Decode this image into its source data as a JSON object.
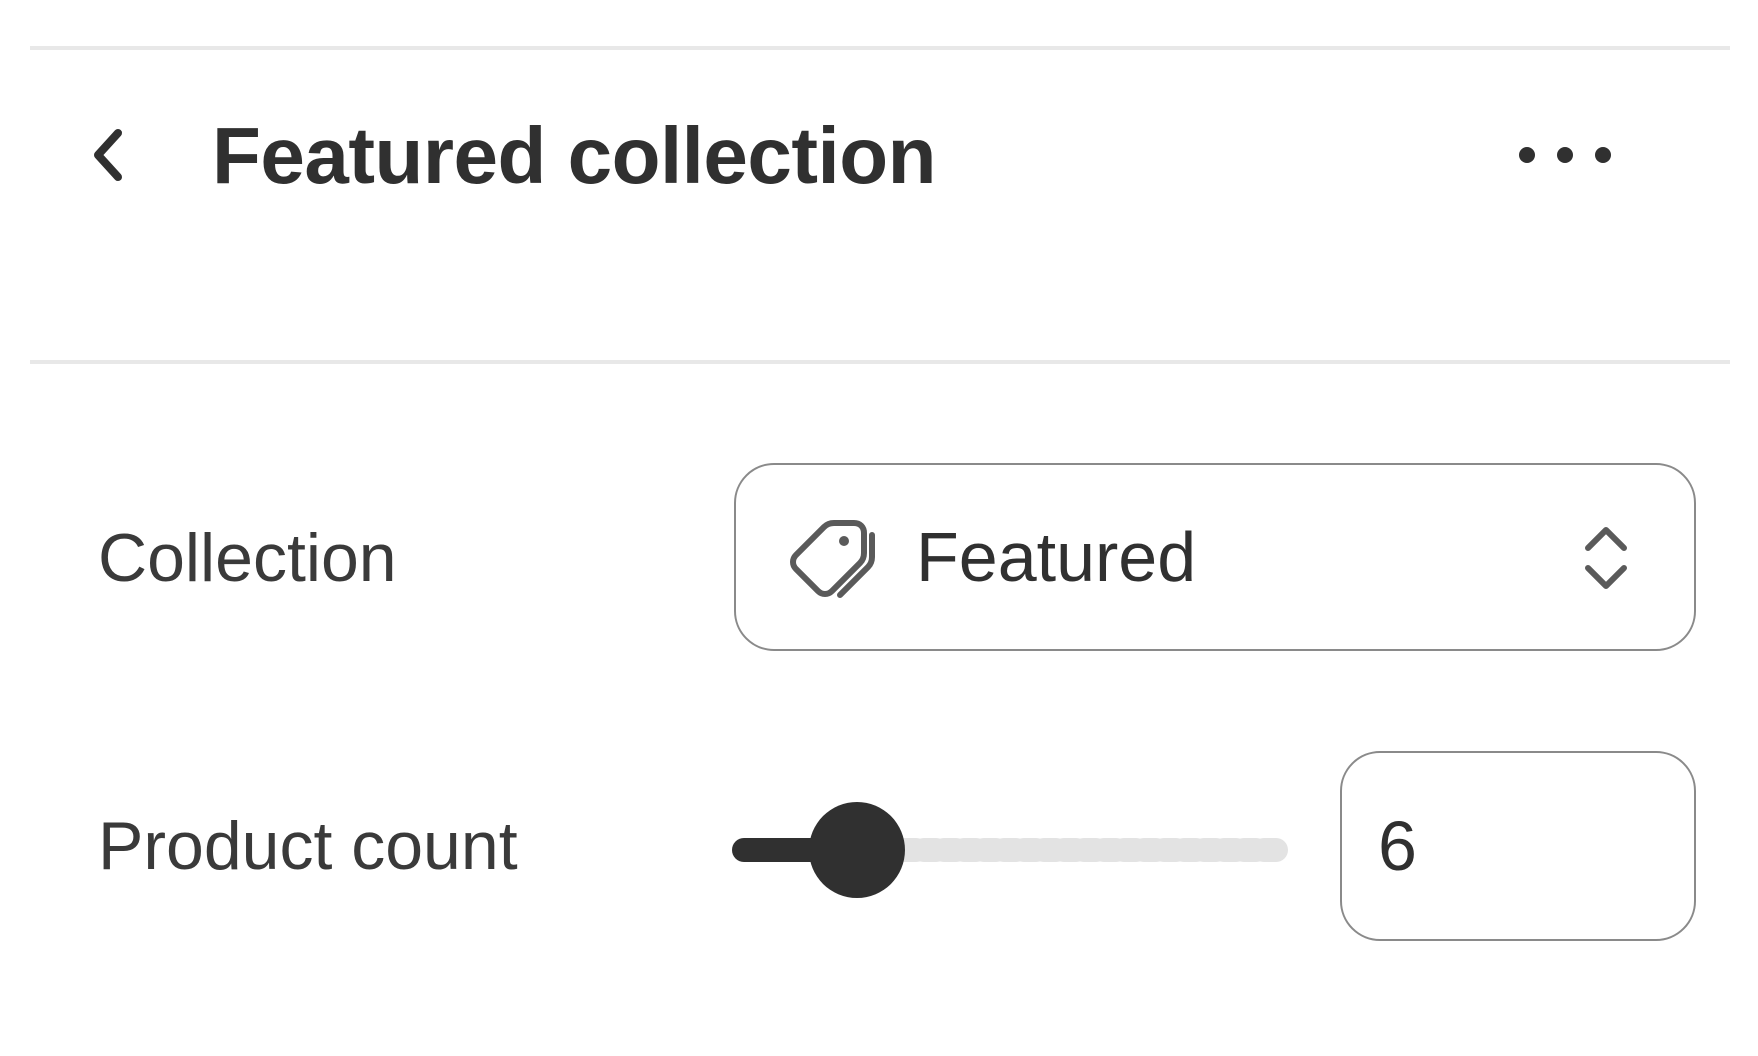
{
  "header": {
    "back_icon": "chevron-left-icon",
    "title": "Featured collection",
    "more_icon": "ellipsis-horizontal-icon"
  },
  "settings": {
    "collection": {
      "label": "Collection",
      "icon": "tag-icon",
      "value": "Featured",
      "select_icon": "select-chevrons-icon"
    },
    "product_count": {
      "label": "Product count",
      "value": "6",
      "slider_fraction": 0.21
    }
  },
  "colors": {
    "text": "#303030",
    "border": "#8a8a8a",
    "divider": "#e8e8e8",
    "slider_fill": "#303030",
    "slider_track": "#e3e3e3"
  }
}
